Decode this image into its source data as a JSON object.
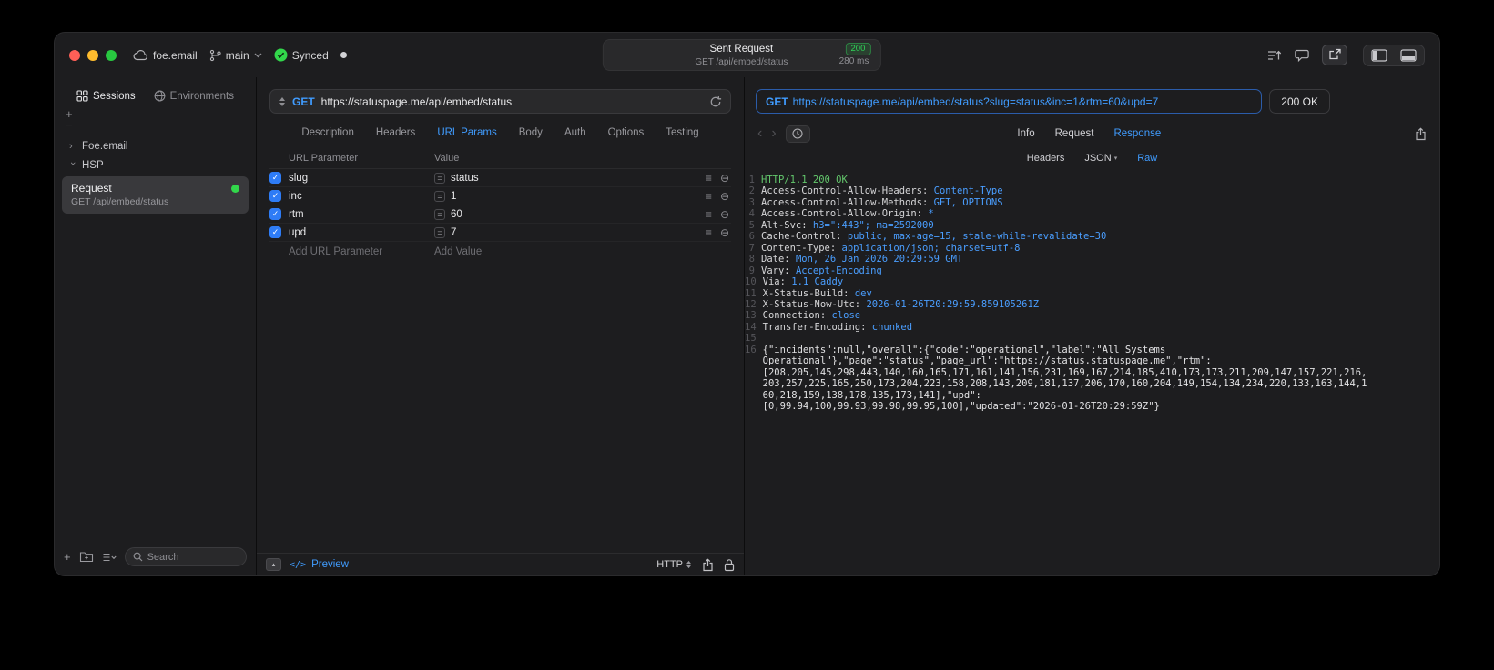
{
  "colors": {
    "accent": "#409cff",
    "success": "#32d74b",
    "method_blue": "#409cff"
  },
  "icons": {
    "check": "✓",
    "reorder": "≡",
    "remove": "⊖",
    "equals": "=",
    "add": "+",
    "subtract": "−",
    "back": "‹",
    "forward": "›",
    "collapse": "▴",
    "code": "</>",
    "chevron_down": "▾"
  },
  "titlebar": {
    "project": "foe.email",
    "branch": "main",
    "sync_label": "Synced",
    "request_summary": {
      "title": "Sent Request",
      "status_code": "200",
      "method_path": "GET /api/embed/status",
      "duration": "280 ms"
    }
  },
  "sidebar": {
    "tabs": [
      {
        "label": "Sessions",
        "active": true
      },
      {
        "label": "Environments",
        "active": false
      }
    ],
    "tree": [
      {
        "label": "Foe.email",
        "expanded": false
      },
      {
        "label": "HSP",
        "expanded": true
      }
    ],
    "request_item": {
      "title": "Request",
      "subtitle": "GET /api/embed/status"
    },
    "search": {
      "placeholder": "Search"
    }
  },
  "request": {
    "method": "GET",
    "url": "https://statuspage.me/api/embed/status",
    "tabs": [
      "Description",
      "Headers",
      "URL Params",
      "Body",
      "Auth",
      "Options",
      "Testing"
    ],
    "active_tab": "URL Params",
    "params": {
      "columns": [
        "URL Parameter",
        "Value"
      ],
      "rows": [
        {
          "name": "slug",
          "value": "status",
          "checked": true
        },
        {
          "name": "inc",
          "value": "1",
          "checked": true
        },
        {
          "name": "rtm",
          "value": "60",
          "checked": true
        },
        {
          "name": "upd",
          "value": "7",
          "checked": true
        }
      ],
      "add_parameter_label": "Add URL Parameter",
      "add_value_label": "Add Value"
    },
    "footer": {
      "preview_label": "Preview",
      "protocol": "HTTP"
    }
  },
  "response": {
    "request_line": {
      "method": "GET",
      "url": "https://statuspage.me/api/embed/status?slug=status&inc=1&rtm=60&upd=7"
    },
    "status": "200 OK",
    "tabs": [
      "Info",
      "Request",
      "Response"
    ],
    "active_tab": "Response",
    "subtabs": [
      "Headers",
      "JSON",
      "Raw"
    ],
    "active_subtab": "Raw",
    "dropdown_subtab": "JSON",
    "body_lines": [
      {
        "n": "1",
        "segments": [
          {
            "cls": "green",
            "text": "HTTP/1.1 200 OK"
          }
        ]
      },
      {
        "n": "2",
        "segments": [
          {
            "cls": "plain",
            "text": "Access-Control-Allow-Headers: "
          },
          {
            "cls": "blue",
            "text": "Content-Type"
          }
        ]
      },
      {
        "n": "3",
        "segments": [
          {
            "cls": "plain",
            "text": "Access-Control-Allow-Methods: "
          },
          {
            "cls": "blue",
            "text": "GET, OPTIONS"
          }
        ]
      },
      {
        "n": "4",
        "segments": [
          {
            "cls": "plain",
            "text": "Access-Control-Allow-Origin: "
          },
          {
            "cls": "blue",
            "text": "*"
          }
        ]
      },
      {
        "n": "5",
        "segments": [
          {
            "cls": "plain",
            "text": "Alt-Svc: "
          },
          {
            "cls": "blue",
            "text": "h3=\":443\"; ma=2592000"
          }
        ]
      },
      {
        "n": "6",
        "segments": [
          {
            "cls": "plain",
            "text": "Cache-Control: "
          },
          {
            "cls": "blue",
            "text": "public, max-age=15, stale-while-revalidate=30"
          }
        ]
      },
      {
        "n": "7",
        "segments": [
          {
            "cls": "plain",
            "text": "Content-Type: "
          },
          {
            "cls": "blue",
            "text": "application/json; charset=utf-8"
          }
        ]
      },
      {
        "n": "8",
        "segments": [
          {
            "cls": "plain",
            "text": "Date: "
          },
          {
            "cls": "blue",
            "text": "Mon, 26 Jan 2026 20:29:59 GMT"
          }
        ]
      },
      {
        "n": "9",
        "segments": [
          {
            "cls": "plain",
            "text": "Vary: "
          },
          {
            "cls": "blue",
            "text": "Accept-Encoding"
          }
        ]
      },
      {
        "n": "10",
        "segments": [
          {
            "cls": "plain",
            "text": "Via: "
          },
          {
            "cls": "blue",
            "text": "1.1 Caddy"
          }
        ]
      },
      {
        "n": "11",
        "segments": [
          {
            "cls": "plain",
            "text": "X-Status-Build: "
          },
          {
            "cls": "blue",
            "text": "dev"
          }
        ]
      },
      {
        "n": "12",
        "segments": [
          {
            "cls": "plain",
            "text": "X-Status-Now-Utc: "
          },
          {
            "cls": "blue",
            "text": "2026-01-26T20:29:59.859105261Z"
          }
        ]
      },
      {
        "n": "13",
        "segments": [
          {
            "cls": "plain",
            "text": "Connection: "
          },
          {
            "cls": "blue",
            "text": "close"
          }
        ]
      },
      {
        "n": "14",
        "segments": [
          {
            "cls": "plain",
            "text": "Transfer-Encoding: "
          },
          {
            "cls": "blue",
            "text": "chunked"
          }
        ]
      },
      {
        "n": "15",
        "segments": []
      },
      {
        "n": "16",
        "segments": [
          {
            "cls": "body",
            "text": "{\"incidents\":null,\"overall\":{\"code\":\"operational\",\"label\":\"All Systems\nOperational\"},\"page\":\"status\",\"page_url\":\"https://status.statuspage.me\",\"rtm\":\n[208,205,145,298,443,140,160,165,171,161,141,156,231,169,167,214,185,410,173,173,211,209,147,157,221,216,\n203,257,225,165,250,173,204,223,158,208,143,209,181,137,206,170,160,204,149,154,134,234,220,133,163,144,1\n60,218,159,138,178,135,173,141],\"upd\":\n[0,99.94,100,99.93,99.98,99.95,100],\"updated\":\"2026-01-26T20:29:59Z\"}"
          }
        ]
      }
    ]
  }
}
